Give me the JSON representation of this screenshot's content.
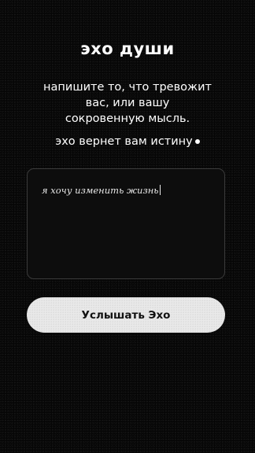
{
  "header": {
    "title": "эхо души"
  },
  "intro": {
    "line1": "напишите то, что тревожит",
    "line2": "вас, или вашу",
    "line3": "сокровенную мысль.",
    "tagline": "эхо вернет вам истину"
  },
  "input": {
    "value": "я хочу изменить жизнь"
  },
  "action": {
    "label": "Услышать Эхо"
  },
  "colors": {
    "background": "#060606",
    "text": "#ffffff",
    "button_bg": "#e9e9e9",
    "button_text": "#111111",
    "input_border": "#3a3a3a"
  }
}
